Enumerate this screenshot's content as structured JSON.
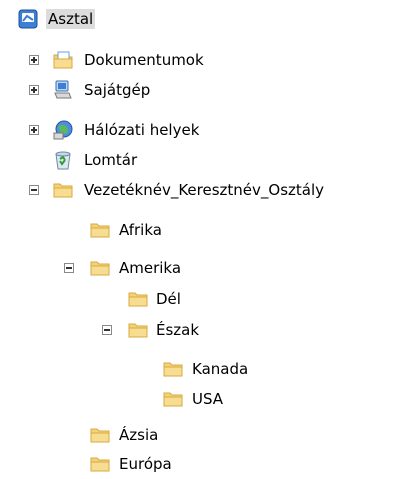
{
  "tree": {
    "root": {
      "label": "Asztal",
      "icon": "desktop-icon",
      "selected": true
    },
    "items": [
      {
        "label": "Dokumentumok",
        "icon": "documents-folder-icon",
        "toggle": "expand"
      },
      {
        "label": "Sajátgép",
        "icon": "computer-icon",
        "toggle": "expand"
      },
      {
        "label": "Hálózati helyek",
        "icon": "network-places-icon",
        "toggle": "expand"
      },
      {
        "label": "Lomtár",
        "icon": "recycle-bin-icon"
      },
      {
        "label": "Vezetéknév_Keresztnév_Osztály",
        "icon": "folder-icon",
        "toggle": "collapse"
      },
      {
        "label": "Afrika",
        "icon": "folder-icon"
      },
      {
        "label": "Amerika",
        "icon": "folder-icon",
        "toggle": "collapse"
      },
      {
        "label": "Dél",
        "icon": "folder-icon"
      },
      {
        "label": "Észak",
        "icon": "folder-icon",
        "toggle": "collapse"
      },
      {
        "label": "Kanada",
        "icon": "folder-icon"
      },
      {
        "label": "USA",
        "icon": "folder-icon"
      },
      {
        "label": "Ázsia",
        "icon": "folder-icon"
      },
      {
        "label": "Európa",
        "icon": "folder-icon"
      }
    ]
  },
  "colors": {
    "folder": "#f3d27a",
    "folder_dark": "#d9a93d",
    "selection": "#dcdcdc"
  }
}
